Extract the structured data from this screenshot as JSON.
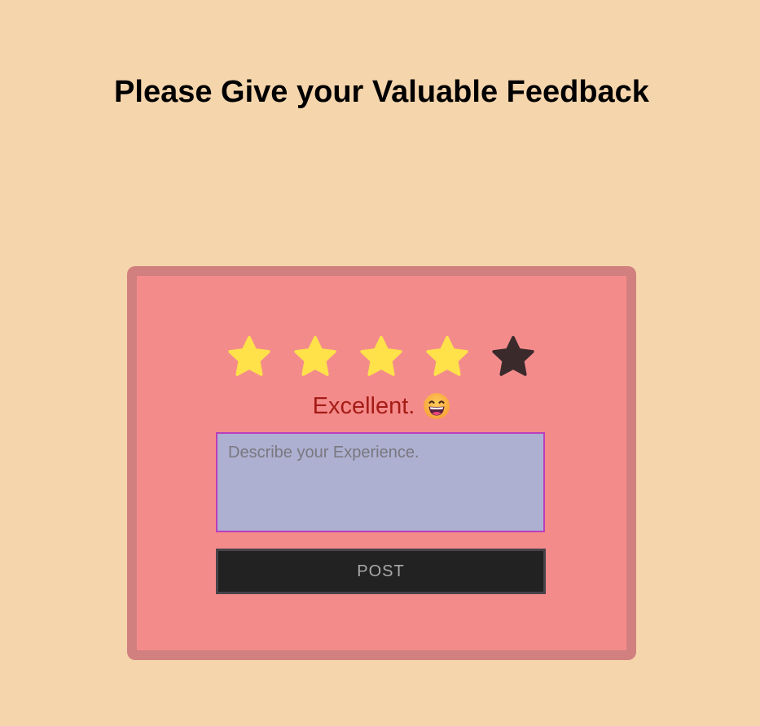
{
  "header": {
    "title": "Please Give your Valuable Feedback"
  },
  "rating": {
    "value": 4,
    "max": 5,
    "stars": [
      {
        "icon": "star-icon",
        "filled": true
      },
      {
        "icon": "star-icon",
        "filled": true
      },
      {
        "icon": "star-icon",
        "filled": true
      },
      {
        "icon": "star-icon",
        "filled": true
      },
      {
        "icon": "star-icon",
        "filled": false
      }
    ],
    "label": "Excellent.",
    "emoji_icon": "grinning-face-icon",
    "label_color": "#a51c16"
  },
  "feedback": {
    "placeholder": "Describe your Experience.",
    "value": ""
  },
  "actions": {
    "post_label": "POST"
  },
  "colors": {
    "background": "#f5d5ac",
    "card": "#f48b8b",
    "card_border": "#d2807f",
    "star_filled": "#ffe14a",
    "star_empty": "#3b2a2c",
    "textarea_bg": "#adb0d0",
    "textarea_border": "#b93fbd",
    "button_bg": "#222222",
    "button_text": "#a9a9a9"
  }
}
